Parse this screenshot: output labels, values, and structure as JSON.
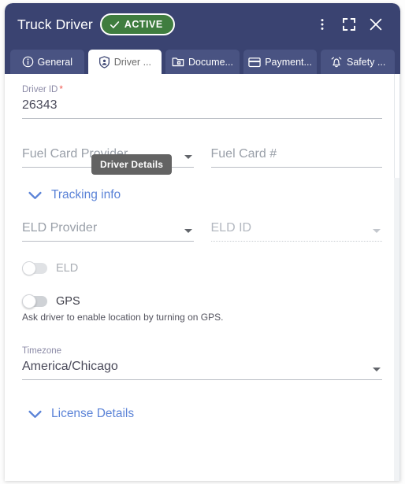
{
  "header": {
    "title": "Truck Driver",
    "status_badge": {
      "label": "ACTIVE",
      "icon": "check-icon",
      "color": "#3f7d3f"
    },
    "actions": [
      {
        "name": "more-options",
        "icon": "kebab-menu-icon"
      },
      {
        "name": "fullscreen",
        "icon": "fullscreen-icon"
      },
      {
        "name": "close",
        "icon": "close-icon"
      }
    ],
    "bg_color": "#3a4371"
  },
  "tabs": [
    {
      "label": "General",
      "icon": "info-circle-icon",
      "active": false
    },
    {
      "label": "Driver ...",
      "icon": "shield-person-icon",
      "active": true
    },
    {
      "label": "Docume...",
      "icon": "folder-document-icon",
      "active": false
    },
    {
      "label": "Payment...",
      "icon": "credit-card-icon",
      "active": false
    },
    {
      "label": "Safety ...",
      "icon": "alarm-bell-icon",
      "active": false
    }
  ],
  "tooltip": {
    "text": "Driver Details"
  },
  "form": {
    "driver_id": {
      "label": "Driver ID",
      "required_marker": "*",
      "value": "26343"
    },
    "fuel_card_provider": {
      "placeholder": "Fuel Card Provider",
      "value": "",
      "icon": "chevron-down-icon"
    },
    "fuel_card_number": {
      "placeholder": "Fuel Card #",
      "value": ""
    },
    "tracking_section": {
      "label": "Tracking info",
      "icon": "chevron-down-icon",
      "expanded": true,
      "color": "#5b83d7"
    },
    "eld_provider": {
      "placeholder": "ELD Provider",
      "value": "",
      "icon": "chevron-down-icon",
      "disabled": false
    },
    "eld_id": {
      "placeholder": "ELD ID",
      "value": "",
      "icon": "chevron-down-icon",
      "disabled": true
    },
    "eld_toggle": {
      "label": "ELD",
      "on": false,
      "disabled": true
    },
    "gps_toggle": {
      "label": "GPS",
      "on": false,
      "disabled": false,
      "helper_text": "Ask driver to enable location by turning on GPS."
    },
    "timezone": {
      "label": "Timezone",
      "value": "America/Chicago",
      "icon": "chevron-down-icon"
    },
    "license_section": {
      "label": "License Details",
      "icon": "chevron-down-icon",
      "expanded": false,
      "color": "#5b83d7"
    }
  }
}
